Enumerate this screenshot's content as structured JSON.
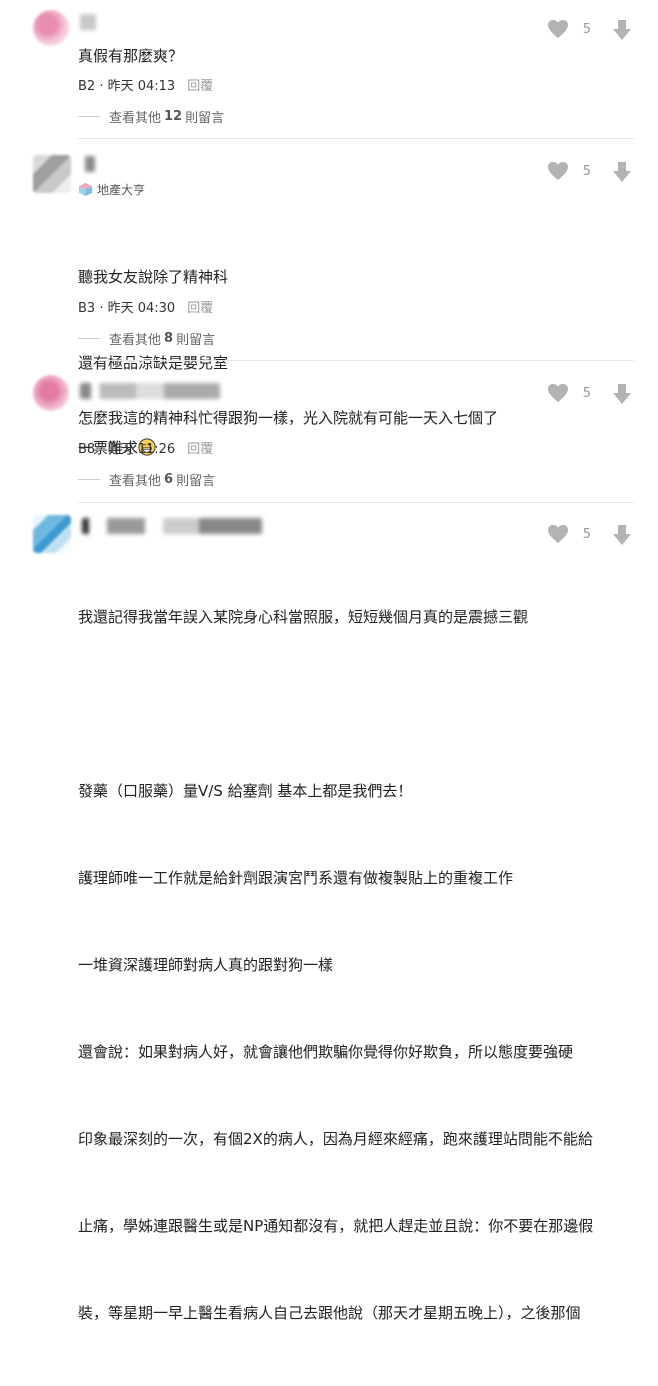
{
  "icons": {
    "like": "heart-icon",
    "dislike": "down-arrow-icon",
    "badge": "cube-icon",
    "emoji": "grinning-face-emoji"
  },
  "colors": {
    "icon_grey": "#b3b3b3",
    "text": "#222222",
    "muted": "#999999",
    "divider": "#e8e8e8"
  },
  "comments": [
    {
      "likes": "5",
      "text": "真假有那麼爽？",
      "floor": "B2",
      "time": "昨天 04:13",
      "reply": "回覆",
      "more_prefix": "查看其他",
      "more_count": "12",
      "more_suffix": "則留言"
    },
    {
      "likes": "5",
      "badge": "地產大亨",
      "lines": [
        "聽我女友說除了精神科",
        "還有極品涼缺是嬰兒室",
        "一票難求"
      ],
      "floor": "B3",
      "time": "昨天 04:30",
      "reply": "回覆",
      "more_prefix": "查看其他",
      "more_count": "8",
      "more_suffix": "則留言"
    },
    {
      "likes": "5",
      "text": "怎麼我這的精神科忙得跟狗一樣，光入院就有可能一天入七個了",
      "floor": "B8",
      "time": "昨天 11:26",
      "reply": "回覆",
      "more_prefix": "查看其他",
      "more_count": "6",
      "more_suffix": "則留言"
    },
    {
      "likes": "5",
      "lines": [
        "我還記得我當年誤入某院身心科當照服，短短幾個月真的是震撼三觀",
        "",
        "發藥（口服藥）量V/S 給塞劑 基本上都是我們去！",
        "護理師唯一工作就是給針劑跟演宮鬥系還有做複製貼上的重複工作",
        "一堆資深護理師對病人真的跟對狗一樣",
        "還會說：如果對病人好，就會讓他們欺騙你覺得你好欺負，所以態度要強硬",
        "印象最深刻的一次，有個2X的病人，因為月經來經痛，跑來護理站問能不能給",
        "止痛，學姊連跟醫生或是NP通知都沒有，就把人趕走並且說：你不要在那邊假",
        "裝，等星期一早上醫生看病人自己去跟他說（那天才星期五晚上），之後那個"
      ]
    }
  ]
}
